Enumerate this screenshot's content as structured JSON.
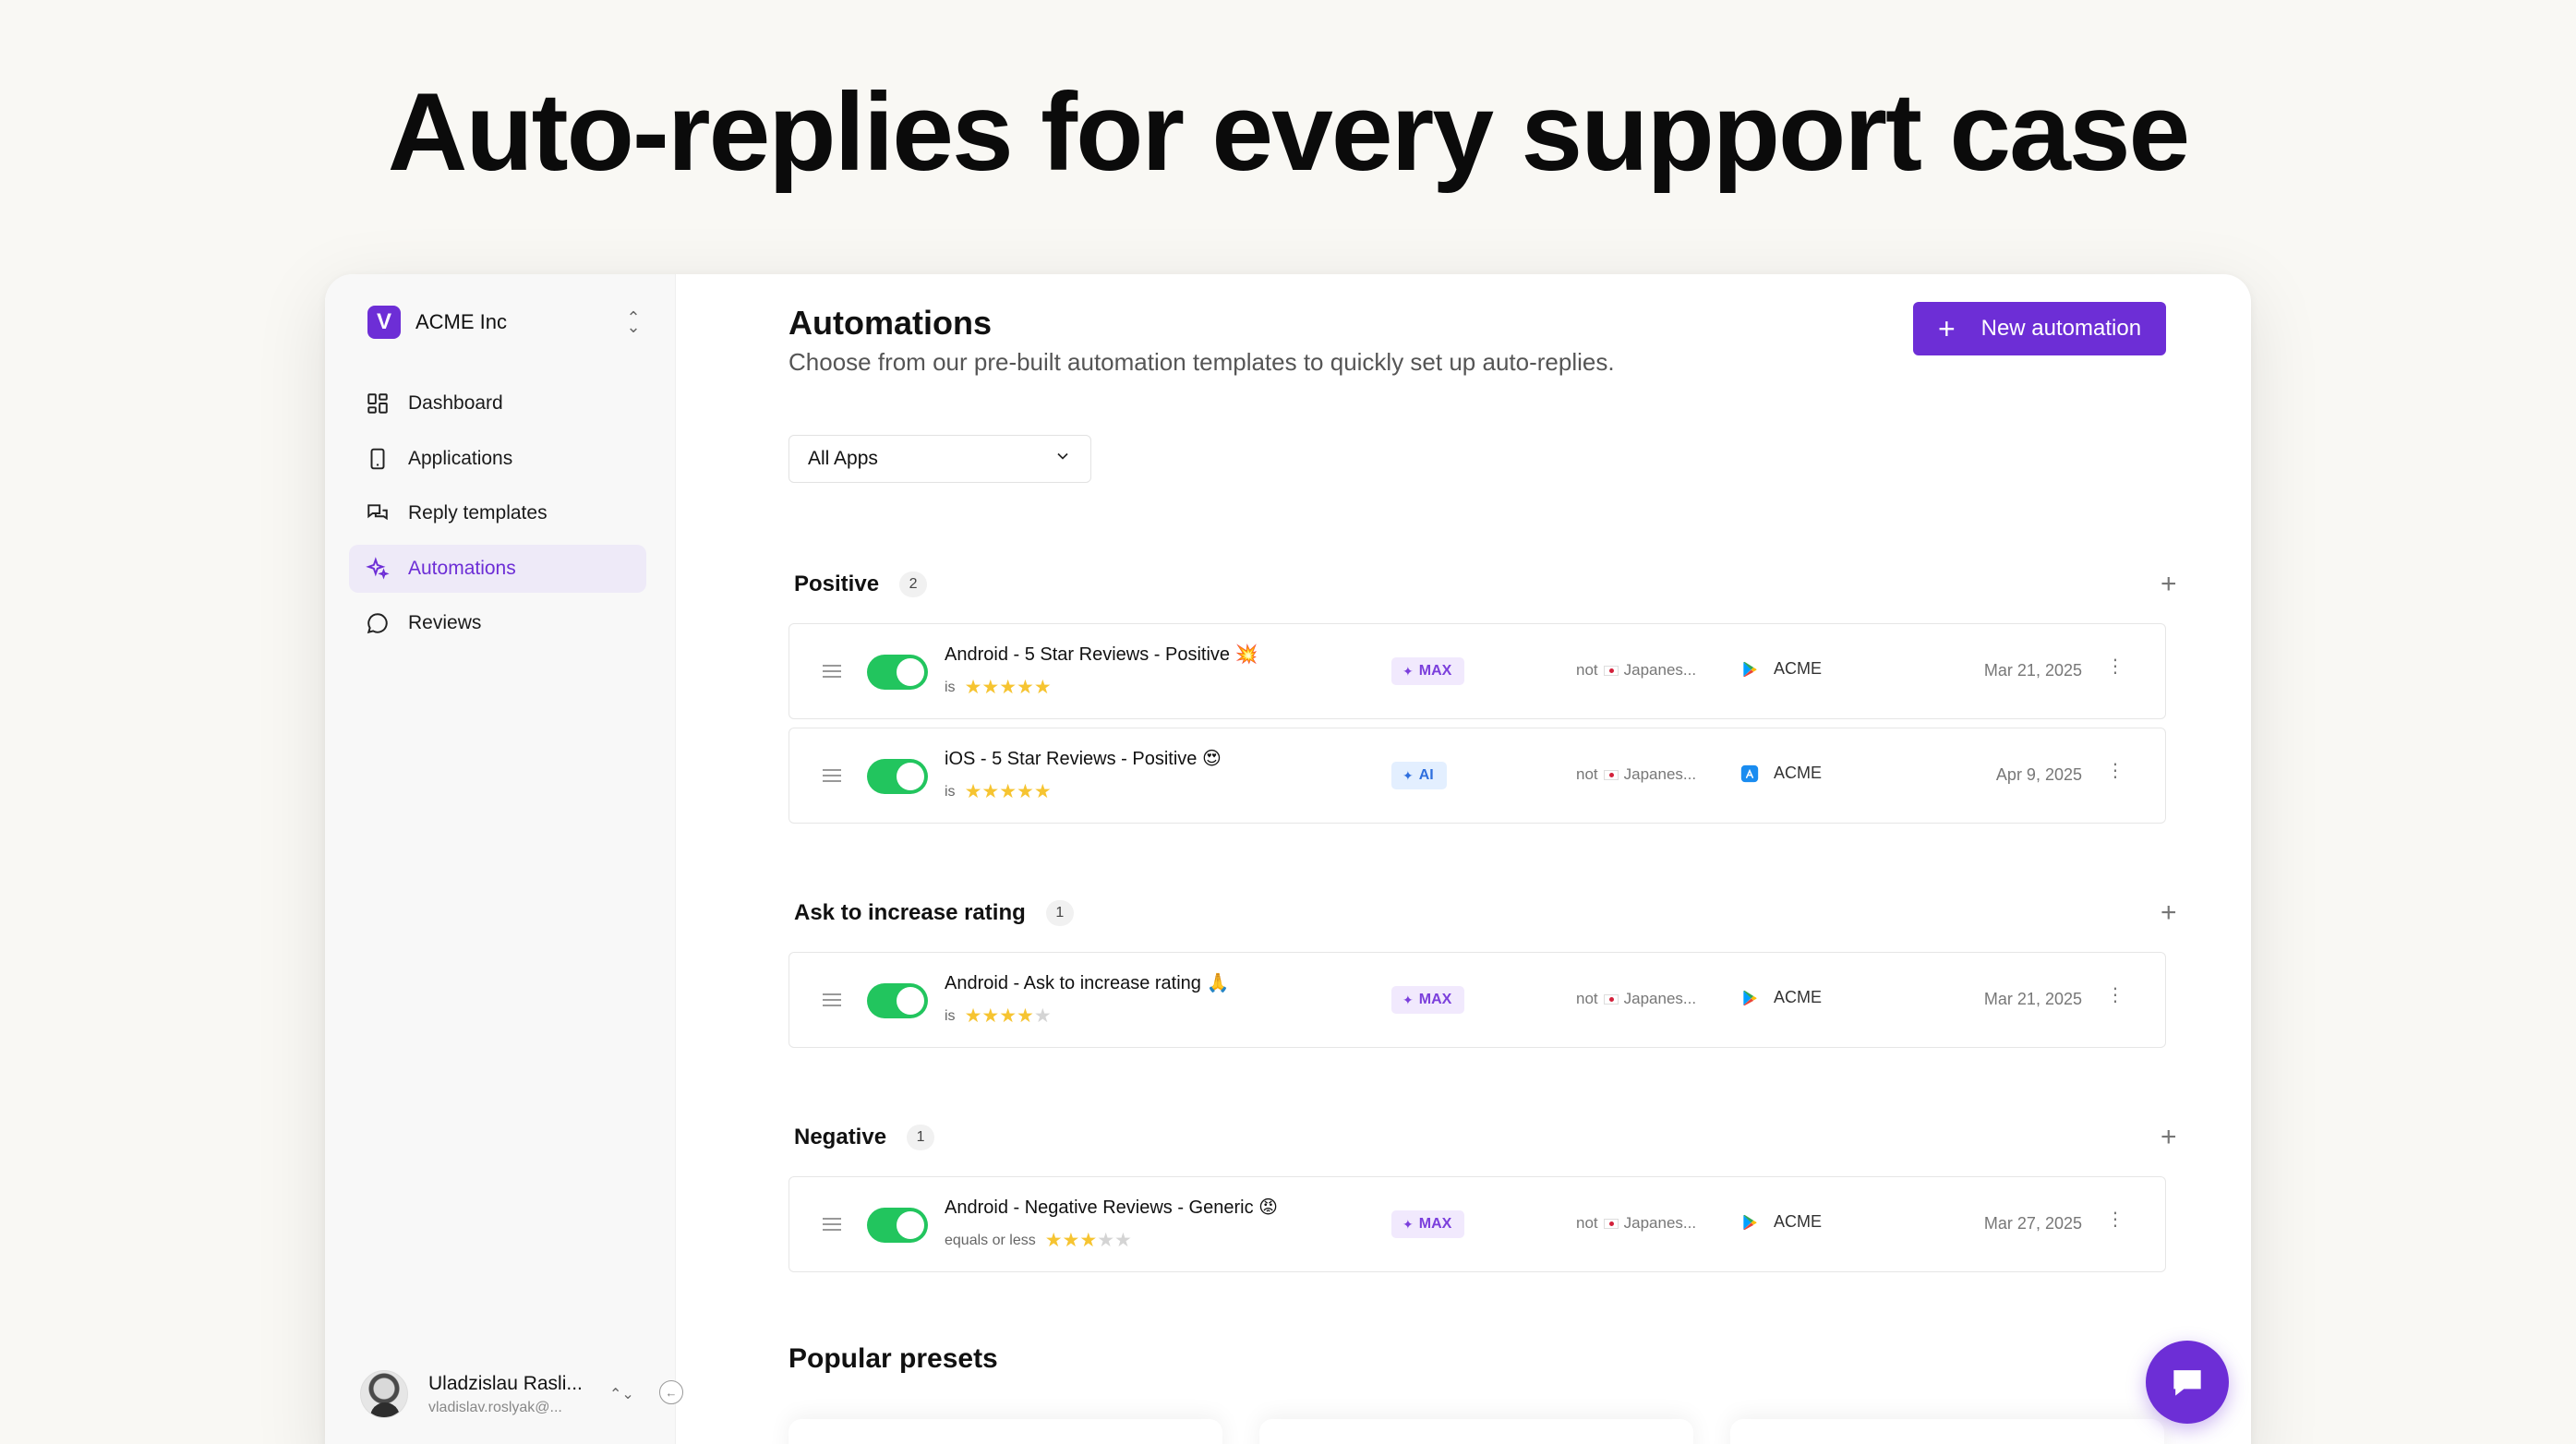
{
  "headline": "Auto-replies for every support case",
  "colors": {
    "accent": "#6d2ed6",
    "toggle_on": "#22c55e",
    "star": "#f6c431"
  },
  "org": {
    "logo_letter": "V",
    "name": "ACME Inc"
  },
  "nav": [
    {
      "label": "Dashboard",
      "icon": "dashboard-icon"
    },
    {
      "label": "Applications",
      "icon": "phone-icon"
    },
    {
      "label": "Reply templates",
      "icon": "chat-bubbles-icon"
    },
    {
      "label": "Automations",
      "icon": "sparkle-icon",
      "active": true
    },
    {
      "label": "Reviews",
      "icon": "message-circle-icon"
    }
  ],
  "user": {
    "name": "Uladzislau Rasli...",
    "email": "vladislav.roslyak@..."
  },
  "page": {
    "title": "Automations",
    "subtitle": "Choose from our pre-built automation templates to quickly set up auto-replies.",
    "new_button": "New automation",
    "app_filter": "All Apps"
  },
  "groups": [
    {
      "title": "Positive",
      "count": "2",
      "items": [
        {
          "name": "Android - 5 Star Reviews - Positive 💥",
          "cond": "is",
          "rating": 5,
          "badge": "MAX",
          "badge_type": "max",
          "lang_prefix": "not",
          "lang": "Japanes...",
          "store": "google-play-icon",
          "app": "ACME",
          "date": "Mar 21, 2025",
          "enabled": true
        },
        {
          "name": "iOS - 5 Star Reviews - Positive 😍",
          "cond": "is",
          "rating": 5,
          "badge": "AI",
          "badge_type": "ai",
          "lang_prefix": "not",
          "lang": "Japanes...",
          "store": "app-store-icon",
          "app": "ACME",
          "date": "Apr 9, 2025",
          "enabled": true
        }
      ]
    },
    {
      "title": "Ask to increase rating",
      "count": "1",
      "items": [
        {
          "name": "Android - Ask to increase rating 🙏",
          "cond": "is",
          "rating": 4,
          "badge": "MAX",
          "badge_type": "max",
          "lang_prefix": "not",
          "lang": "Japanes...",
          "store": "google-play-icon",
          "app": "ACME",
          "date": "Mar 21, 2025",
          "enabled": true
        }
      ]
    },
    {
      "title": "Negative",
      "count": "1",
      "items": [
        {
          "name": "Android - Negative Reviews - Generic 😡",
          "cond": "equals or less",
          "rating": 3,
          "badge": "MAX",
          "badge_type": "max",
          "lang_prefix": "not",
          "lang": "Japanes...",
          "store": "google-play-icon",
          "app": "ACME",
          "date": "Mar 27, 2025",
          "enabled": true
        }
      ]
    }
  ],
  "presets": {
    "title": "Popular presets"
  }
}
